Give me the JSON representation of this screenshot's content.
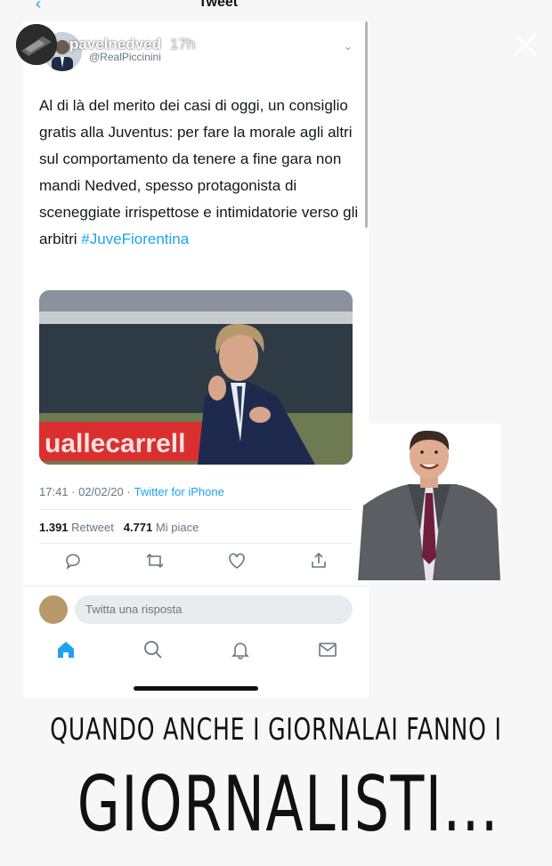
{
  "nav": {
    "back_icon": "chevron-left-icon",
    "title": "Tweet"
  },
  "story": {
    "username": "pavelnedved",
    "time": "17h",
    "close_icon": "close-icon"
  },
  "tweet": {
    "handle": "@RealPiccinini",
    "text": "Al di là del merito dei casi di oggi, un consiglio gratis alla Juventus: per fare la morale agli altri sul comportamento da tenere a fine gara non mandi Nedved, spesso protagonista di sceneggiate irrispettose e intimidatorie verso gli arbitri",
    "hashtag": "#JuveFiorentina",
    "timestamp": "17:41 · 02/02/20 ·",
    "source": "Twitter for iPhone",
    "retweets": "1.391",
    "retweets_label": "Retweet",
    "likes": "4.771",
    "likes_label": "Mi piace",
    "reply_placeholder": "Twitta una risposta",
    "photo_text": "uallecarrell"
  },
  "colors": {
    "link": "#1da1f2",
    "muted": "#657786",
    "text": "#14171a"
  },
  "caption": {
    "line1": "QUANDO ANCHE I GIORNALAI FANNO I",
    "line2": "GIORNALISTI..."
  }
}
